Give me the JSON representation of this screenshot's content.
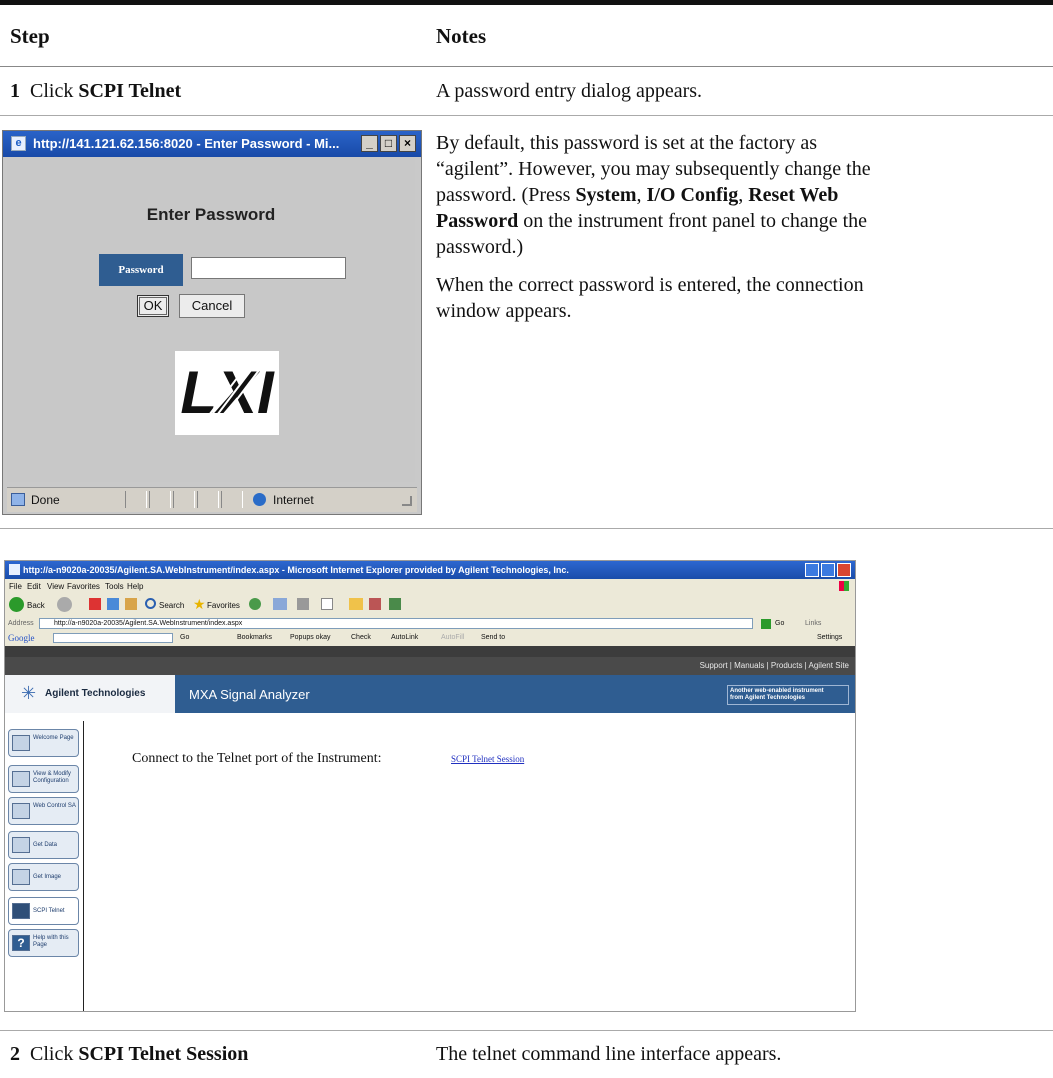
{
  "table": {
    "header_step": "Step",
    "header_notes": "Notes"
  },
  "row1": {
    "number": "1",
    "step_prefix": "Click ",
    "step_bold": "SCPI Telnet",
    "note": "A password entry dialog appears."
  },
  "row1b": {
    "p1_a": "By default, this password is set at the factory as",
    "p1_b": "“agilent”. However, you may subsequently change the",
    "p1_c_pre": "password. (Press ",
    "p1_c_b1": "System",
    "p1_c_sep1": ", ",
    "p1_c_b2": "I/O Config",
    "p1_c_sep2": ", ",
    "p1_c_b3": "Reset Web",
    "p1_d_b": "Password",
    "p1_d_post": " on the instrument front panel to change the",
    "p1_e": "password.)",
    "p2_a": "When the correct password is entered, the connection",
    "p2_b": "window appears."
  },
  "dialog": {
    "title": "http://141.121.62.156:8020 - Enter Password - Mi...",
    "heading": "Enter Password",
    "password_label": "Password",
    "password_value": "",
    "ok_label": "OK",
    "cancel_label": "Cancel",
    "logo_text": "LXI",
    "status_done": "Done",
    "status_zone": "Internet"
  },
  "browser": {
    "title": "http://a-n9020a-20035/Agilent.SA.WebInstrument/index.aspx - Microsoft Internet Explorer provided by Agilent Technologies, Inc.",
    "menu": [
      "File",
      "Edit",
      "View",
      "Favorites",
      "Tools",
      "Help"
    ],
    "toolbar": {
      "back": "Back",
      "search": "Search",
      "favorites": "Favorites"
    },
    "address_label": "Address",
    "address_value": "http://a-n9020a-20035/Agilent.SA.WebInstrument/index.aspx",
    "go": "Go",
    "links": "Links",
    "google_bar": {
      "logo": "Google",
      "go": "Go",
      "bookmarks": "Bookmarks",
      "popups": "Popups okay",
      "check": "Check",
      "autolink": "AutoLink",
      "autofill": "AutoFill",
      "sendto": "Send to",
      "settings": "Settings"
    },
    "top_links": "Support | Manuals | Products | Agilent Site",
    "brand": "Agilent Technologies",
    "product": "MXA Signal Analyzer",
    "banner_note_1": "Another web-enabled instrument",
    "banner_note_2": "from Agilent Technologies",
    "nav": [
      "Welcome Page",
      "View & Modify Configuration",
      "Web Control SA",
      "Get Data",
      "Get Image",
      "SCPI Telnet",
      "Help with this Page"
    ],
    "main_text": "Connect to the Telnet port of the Instrument:",
    "main_link": "SCPI Telnet Session"
  },
  "row2": {
    "number": "2",
    "step_prefix": "Click ",
    "step_bold": "SCPI Telnet Session",
    "note": "The telnet command line interface appears."
  }
}
